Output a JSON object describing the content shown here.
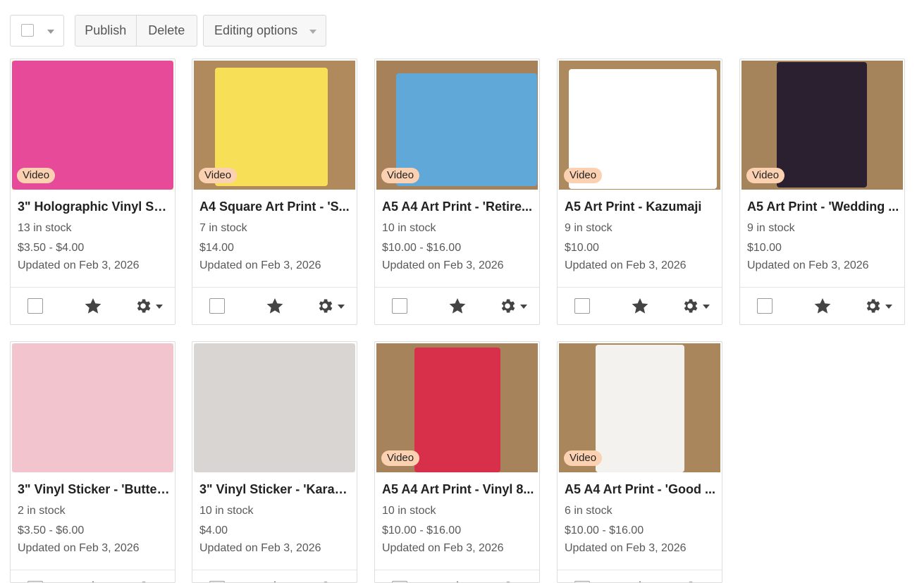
{
  "toolbar": {
    "publish_label": "Publish",
    "delete_label": "Delete",
    "editing_options_label": "Editing options"
  },
  "listings": [
    {
      "title": "3\" Holographic Vinyl Sti...",
      "stock": "13 in stock",
      "price": "$3.50 - $4.00",
      "updated": "Updated on Feb 3, 2026",
      "badge": "Video"
    },
    {
      "title": "A4 Square Art Print - 'S...",
      "stock": "7 in stock",
      "price": "$14.00",
      "updated": "Updated on Feb 3, 2026",
      "badge": "Video"
    },
    {
      "title": "A5 A4 Art Print - 'Retire...",
      "stock": "10 in stock",
      "price": "$10.00 - $16.00",
      "updated": "Updated on Feb 3, 2026",
      "badge": "Video"
    },
    {
      "title": "A5 Art Print - Kazumaji",
      "stock": "9 in stock",
      "price": "$10.00",
      "updated": "Updated on Feb 3, 2026",
      "badge": "Video"
    },
    {
      "title": "A5 Art Print - 'Wedding ...",
      "stock": "9 in stock",
      "price": "$10.00",
      "updated": "Updated on Feb 3, 2026",
      "badge": "Video"
    },
    {
      "title": "3\" Vinyl Sticker - 'Butter...",
      "stock": "2 in stock",
      "price": "$3.50 - $6.00",
      "updated": "Updated on Feb 3, 2026",
      "badge": ""
    },
    {
      "title": "3\" Vinyl Sticker - 'Karao...",
      "stock": "10 in stock",
      "price": "$4.00",
      "updated": "Updated on Feb 3, 2026",
      "badge": ""
    },
    {
      "title": "A5 A4 Art Print - Vinyl 8...",
      "stock": "10 in stock",
      "price": "$10.00 - $16.00",
      "updated": "Updated on Feb 3, 2026",
      "badge": "Video"
    },
    {
      "title": "A5 A4 Art Print - 'Good ...",
      "stock": "6 in stock",
      "price": "$10.00 - $16.00",
      "updated": "Updated on Feb 3, 2026",
      "badge": "Video"
    }
  ],
  "thumb_colors": [
    {
      "bg": "#f5e06a",
      "pic": "#e84a9a"
    },
    {
      "bg": "#b08a5c",
      "pic": "#f7df58"
    },
    {
      "bg": "#a6815a",
      "pic": "#5fa8d8"
    },
    {
      "bg": "#ad8a5e",
      "pic": "#ffffff"
    },
    {
      "bg": "#a5845c",
      "pic": "#2a2030"
    },
    {
      "bg": "#f3e9d6",
      "pic": "#f2c4ce"
    },
    {
      "bg": "#f2f0ee",
      "pic": "#d9d5d3"
    },
    {
      "bg": "#a6835a",
      "pic": "#d8304a"
    },
    {
      "bg": "#a9865c",
      "pic": "#f4f2ef"
    }
  ]
}
